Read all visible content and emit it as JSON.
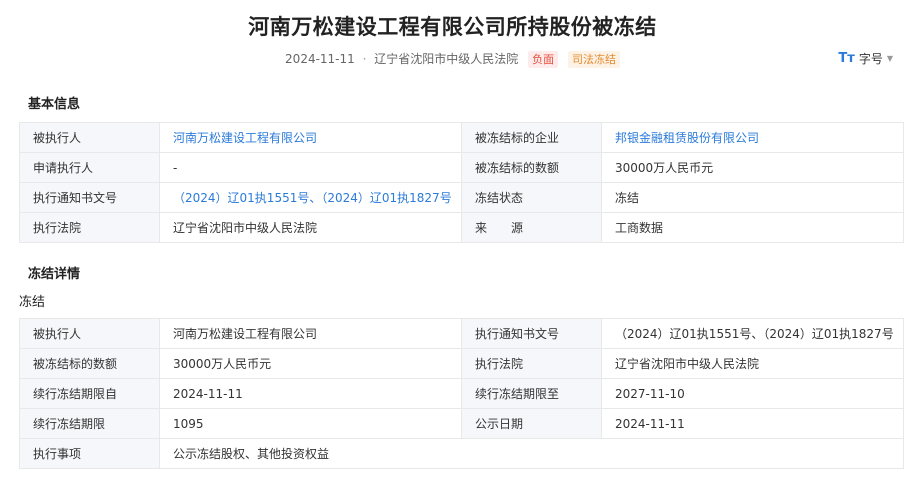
{
  "header": {
    "title": "河南万松建设工程有限公司所持股份被冻结",
    "date": "2024-11-11",
    "separator": "·",
    "court": "辽宁省沈阳市中级人民法院",
    "tags": [
      "负面",
      "司法冻结"
    ],
    "font_size_label": "字号",
    "font_size_icon": "Tт"
  },
  "basic_info": {
    "section_title": "基本信息",
    "rows": [
      [
        {
          "label": "被执行人",
          "value": "河南万松建设工程有限公司",
          "link": true
        },
        {
          "label": "被冻结标的企业",
          "value": "邦银金融租赁股份有限公司",
          "link": true
        }
      ],
      [
        {
          "label": "申请执行人",
          "value": "-",
          "link": false
        },
        {
          "label": "被冻结标的数额",
          "value": "30000万人民币元",
          "link": false
        }
      ],
      [
        {
          "label": "执行通知书文号",
          "value": "（2024）辽01执1551号、（2024）辽01执1827号",
          "link": true
        },
        {
          "label": "冻结状态",
          "value": "冻结",
          "link": false
        }
      ],
      [
        {
          "label": "执行法院",
          "value": "辽宁省沈阳市中级人民法院",
          "link": false
        },
        {
          "label": "来　　源",
          "value": "工商数据",
          "link": false
        }
      ]
    ]
  },
  "freeze_detail": {
    "section_title": "冻结详情",
    "sub_title": "冻结",
    "rows": [
      [
        {
          "label": "被执行人",
          "value": "河南万松建设工程有限公司"
        },
        {
          "label": "执行通知书文号",
          "value": "（2024）辽01执1551号、（2024）辽01执1827号"
        }
      ],
      [
        {
          "label": "被冻结标的数额",
          "value": "30000万人民币元"
        },
        {
          "label": "执行法院",
          "value": "辽宁省沈阳市中级人民法院"
        }
      ],
      [
        {
          "label": "续行冻结期限自",
          "value": "2024-11-11"
        },
        {
          "label": "续行冻结期限至",
          "value": "2027-11-10"
        }
      ],
      [
        {
          "label": "续行冻结期限",
          "value": "1095"
        },
        {
          "label": "公示日期",
          "value": "2024-11-11"
        }
      ],
      [
        {
          "label": "执行事项",
          "value": "公示冻结股权、其他投资权益"
        }
      ]
    ]
  },
  "colors": {
    "link": "#2b7bd9",
    "label_bg": "#f5f7fa",
    "tag_negative": "#e64c3c",
    "tag_freeze": "#e48a2e"
  }
}
